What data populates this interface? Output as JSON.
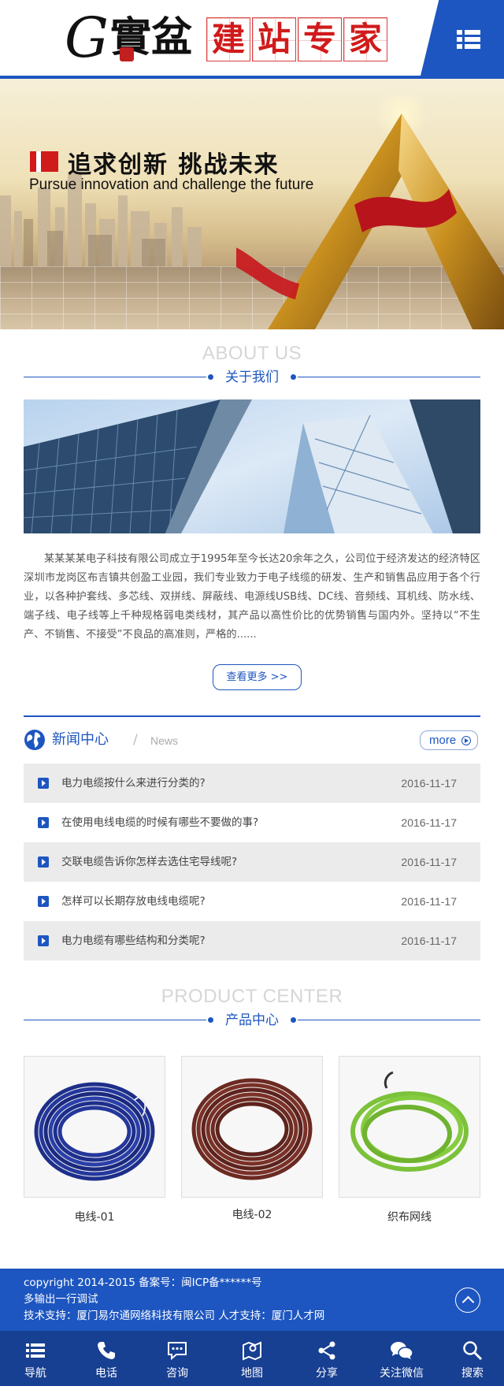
{
  "header": {
    "logo_letter": "G",
    "logo_mark": "實盆",
    "logo_title": [
      "建",
      "站",
      "专",
      "家"
    ],
    "menu_icon": "list-menu-icon"
  },
  "banner": {
    "title": "追求创新  挑战未来",
    "subtitle": "Pursue innovation and challenge the future"
  },
  "about": {
    "title_en": "ABOUT US",
    "title_cn": "关于我们",
    "text": "某某某某电子科技有限公司成立于1995年至今长达20余年之久，公司位于经济发达的经济特区深圳市龙岗区布吉镇共创盈工业园，我们专业致力于电子线缆的研发、生产和销售品应用于各个行业，以各种护套线、多芯线、双拼线、屏蔽线、电源线USB线、DC线、音频线、耳机线、防水线、 端子线、电子线等上千种规格弱电类线材，其产品以高性价比的优势销售与国内外。坚持以“不生产、不销售、不接受”不良品的高准则，严格的......",
    "more_label": "查看更多 >>"
  },
  "news": {
    "title": "新闻中心",
    "separator": "/",
    "title_en": "News",
    "more_label": "more",
    "items": [
      {
        "title": "电力电缆按什么来进行分类的?",
        "date": "2016-11-17"
      },
      {
        "title": "在使用电线电缆的时候有哪些不要做的事?",
        "date": "2016-11-17"
      },
      {
        "title": "交联电缆告诉你怎样去选住宅导线呢?",
        "date": "2016-11-17"
      },
      {
        "title": "怎样可以长期存放电线电缆呢?",
        "date": "2016-11-17"
      },
      {
        "title": "电力电缆有哪些结构和分类呢?",
        "date": "2016-11-17"
      }
    ]
  },
  "products": {
    "title_en": "PRODUCT CENTER",
    "title_cn": "产品中心",
    "items": [
      {
        "name": "电线-01",
        "color": "#1e2f8a"
      },
      {
        "name": "电线-02",
        "color": "#6b2a22"
      },
      {
        "name": "织布网线",
        "color": "#7cc23a"
      }
    ]
  },
  "footer": {
    "line1": "copyright 2014-2015 备案号：闽ICP备******号",
    "line2": "多输出一行调试",
    "line3": "技术支持：厦门易尔通网络科技有限公司 人才支持：厦门人才网"
  },
  "bottom_nav": [
    {
      "label": "导航",
      "icon": "list-icon"
    },
    {
      "label": "电话",
      "icon": "phone-icon"
    },
    {
      "label": "咨询",
      "icon": "chat-icon"
    },
    {
      "label": "地图",
      "icon": "map-icon"
    },
    {
      "label": "分享",
      "icon": "share-icon"
    },
    {
      "label": "关注微信",
      "icon": "wechat-icon"
    },
    {
      "label": "搜索",
      "icon": "search-icon"
    }
  ],
  "colors": {
    "brand_blue": "#1d56c0",
    "nav_blue": "#173f92",
    "accent_red": "#d11a1a"
  }
}
